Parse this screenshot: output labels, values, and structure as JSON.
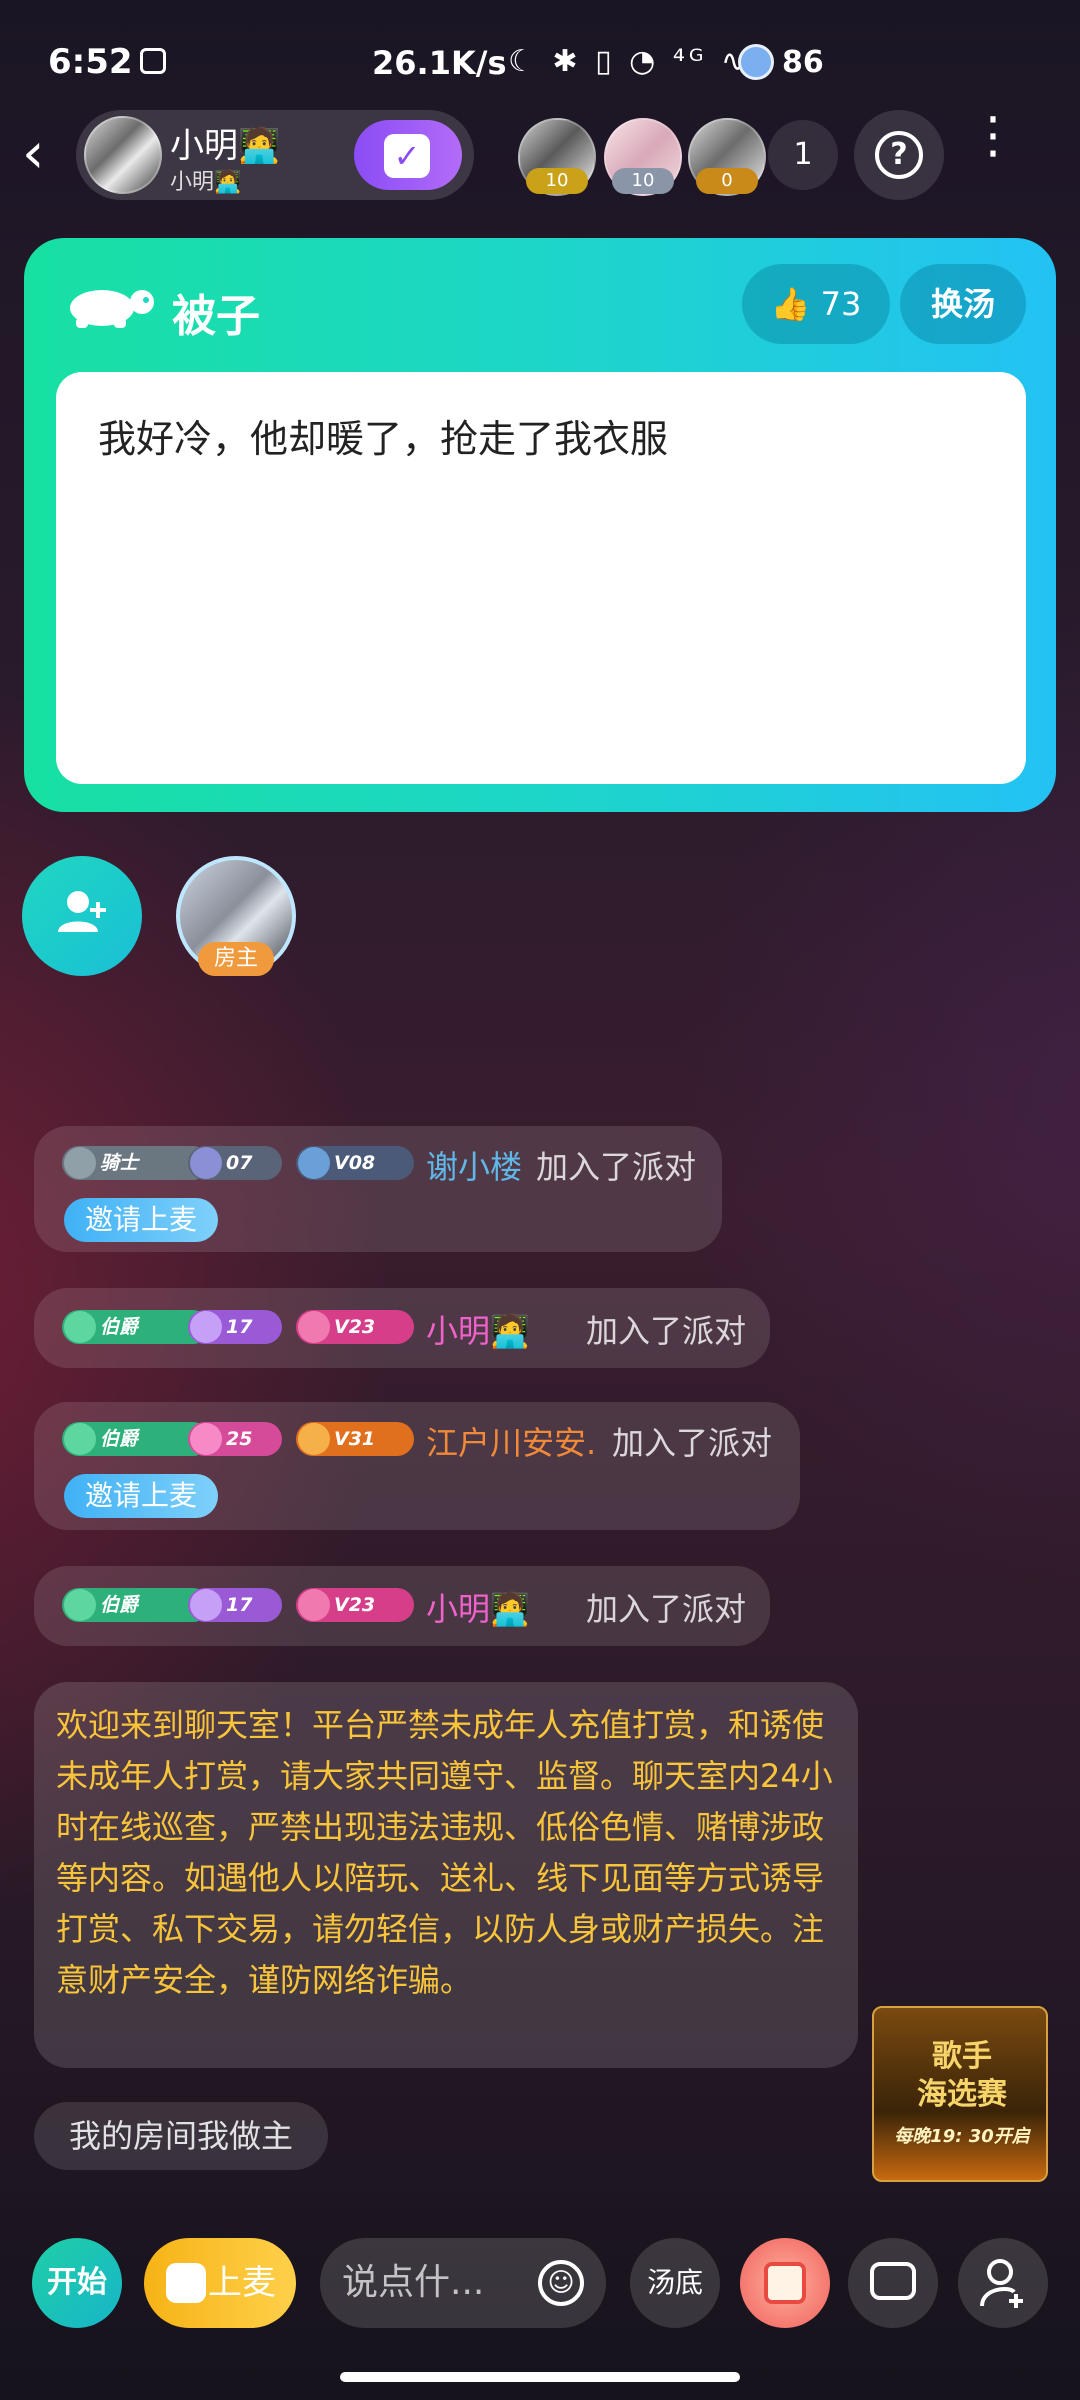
{
  "status_bar": {
    "time": "6:52",
    "net_speed": "26.1K/s",
    "icons_text": "☾ ✱ ▯ ◔ ⁴ᴳ ∿",
    "battery": "86"
  },
  "header": {
    "host_name": "小明🧑‍💻",
    "host_sub": "小明🧑‍💻",
    "checkin_icon": "✓",
    "viewers": [
      {
        "badge": "10",
        "color": "#c9a21a"
      },
      {
        "badge": "10",
        "color": "#8a96a8"
      },
      {
        "badge": "0",
        "color": "#c98a1a"
      }
    ],
    "viewer_count": "1",
    "help_icon": "?",
    "more_icon": "⋮",
    "back_icon": "‹"
  },
  "topic": {
    "title": "被子",
    "likes": "73",
    "like_icon": "👍",
    "switch_label": "换汤",
    "text": "我好冷，他却暖了，抢走了我衣服"
  },
  "seats": {
    "owner_label": "房主"
  },
  "chat": {
    "messages": [
      {
        "badges": [
          "骑士",
          "07",
          "V08"
        ],
        "name": "谢小楼",
        "action": "加入了派对",
        "invite": "邀请上麦",
        "name_color": "#5fb8e8"
      },
      {
        "badges": [
          "伯爵",
          "17",
          "V23"
        ],
        "name": "小明🧑‍💻",
        "action": "加入了派对",
        "name_color": "#ee62c9"
      },
      {
        "badges": [
          "伯爵",
          "25",
          "V31"
        ],
        "name": "江户川安安.",
        "action": "加入了派对",
        "invite": "邀请上麦",
        "name_color": "#f08a3a"
      },
      {
        "badges": [
          "伯爵",
          "17",
          "V23"
        ],
        "name": "小明🧑‍💻",
        "action": "加入了派对",
        "name_color": "#ee62c9"
      }
    ],
    "notice": "欢迎来到聊天室！平台严禁未成年人充值打赏，和诱使未成年人打赏，请大家共同遵守、监督。聊天室内24小时在线巡查，严禁出现违法违规、低俗色情、赌博涉政等内容。如遇他人以陪玩、送礼、线下见面等方式诱导打赏、私下交易，请勿轻信，以防人身或财产损失。注意财产安全，谨防网络诈骗。",
    "tagline": "我的房间我做主"
  },
  "promo": {
    "title_line1": "歌手",
    "title_line2": "海选赛",
    "time": "每晚19: 30开启"
  },
  "bottom_bar": {
    "start_label": "开始",
    "mic_label": "上麦",
    "input_placeholder": "说点什...",
    "emoji_icon": "☺",
    "soup_label": "汤底"
  }
}
